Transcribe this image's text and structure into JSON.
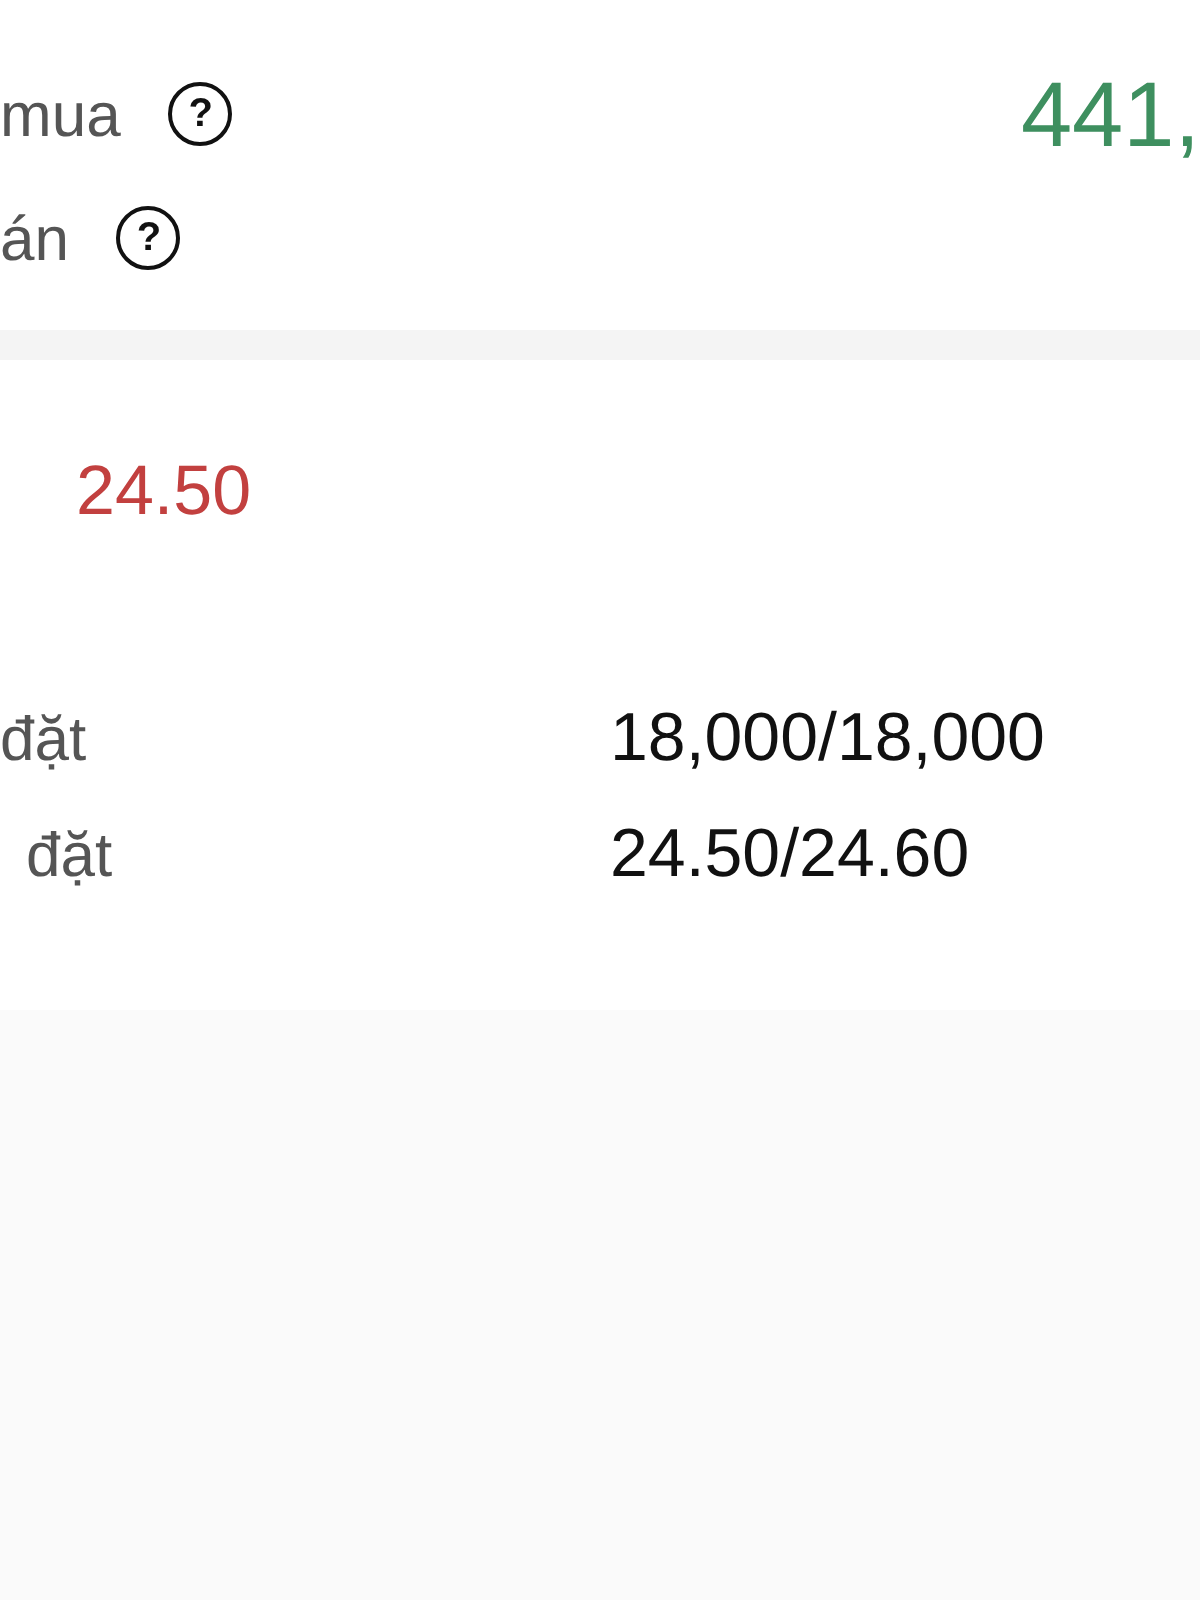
{
  "summary": [
    {
      "label": "mua",
      "help": "?",
      "value": "441,"
    },
    {
      "label": "án",
      "help": "?"
    }
  ],
  "order": {
    "price": "24.50",
    "rows": [
      {
        "label": "đặt",
        "value": "18,000/18,000"
      },
      {
        "label": "đặt",
        "value": "24.50/24.60"
      }
    ]
  }
}
